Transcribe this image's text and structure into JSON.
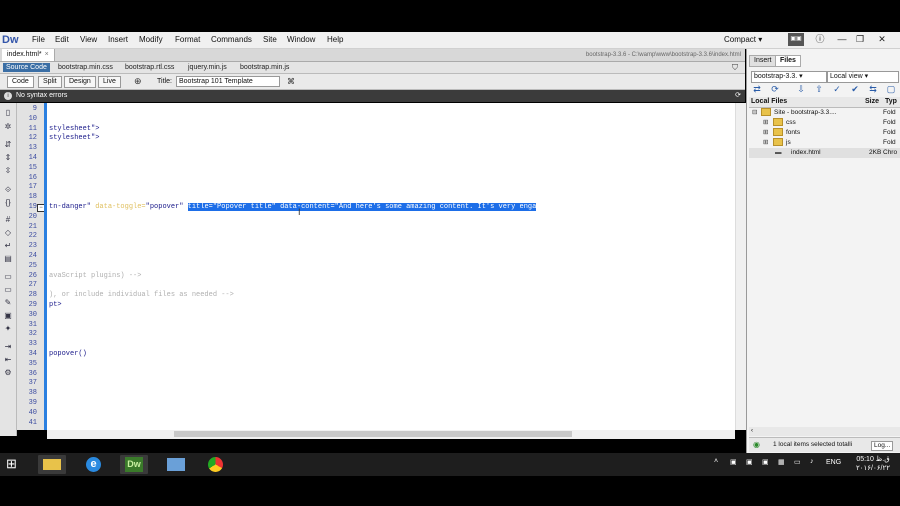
{
  "app": {
    "logo": "Dw",
    "menu": [
      "File",
      "Edit",
      "View",
      "Insert",
      "Modify",
      "Format",
      "Commands",
      "Site",
      "Window",
      "Help"
    ],
    "workspace": "Compact ▾",
    "window_controls": [
      "—",
      "❐",
      "✕"
    ]
  },
  "document": {
    "tab_name": "index.html*",
    "tab_close": "×",
    "path": "bootstrap-3.3.6 - C:\\wamp\\www\\bootstrap-3.3.6\\index.html",
    "related_files": [
      "Source Code",
      "bootstrap.min.css",
      "bootstrap.rtl.css",
      "jquery.min.js",
      "bootstrap.min.js"
    ],
    "view_buttons": [
      "Code",
      "Split",
      "Design",
      "Live"
    ],
    "title_label": "Title:",
    "title_value": "Bootstrap 101 Template",
    "syntax_status": "No syntax errors"
  },
  "code": {
    "line_numbers": [
      "9",
      "10",
      "11",
      "12",
      "13",
      "14",
      "15",
      "16",
      "17",
      "18",
      "19",
      "20",
      "21",
      "22",
      "23",
      "24",
      "25",
      "26",
      "27",
      "28",
      "29",
      "30",
      "31",
      "32",
      "33",
      "34",
      "35",
      "36",
      "37",
      "38",
      "39",
      "40",
      "41"
    ],
    "line11": "stylesheet\">",
    "line12": "stylesheet\">",
    "line19_a": "tn-danger\" ",
    "line19_b": "data-toggle=",
    "line19_c": "\"popover\" ",
    "line19_sel": "title=\"Popover title\" data-content=\"And here's some amazing content. It's very enga",
    "line26": "avaScript plugins) -->",
    "line28": "), or include individual files as needed -->",
    "line29": "pt>",
    "line34": "popover()"
  },
  "files_panel": {
    "tabs": [
      "Insert",
      "Files"
    ],
    "site": "bootstrap-3.3.",
    "view": "Local view",
    "header_name": "Local Files",
    "header_size": "Size",
    "header_type": "Typ",
    "rows": [
      {
        "name": "Site - bootstrap-3.3....",
        "size": "",
        "type": "Fold"
      },
      {
        "name": "css",
        "size": "",
        "type": "Fold"
      },
      {
        "name": "fonts",
        "size": "",
        "type": "Fold"
      },
      {
        "name": "js",
        "size": "",
        "type": "Fold"
      },
      {
        "name": "index.html",
        "size": "2KB",
        "type": "Chro"
      }
    ],
    "status": "1 local items selected totalli",
    "log_button": "Log..."
  },
  "taskbar": {
    "tray_lang": "ENG",
    "clock_time": "05:10 ق.ظ",
    "clock_date": "۲۰۱۶/۰۶/۲۲"
  }
}
